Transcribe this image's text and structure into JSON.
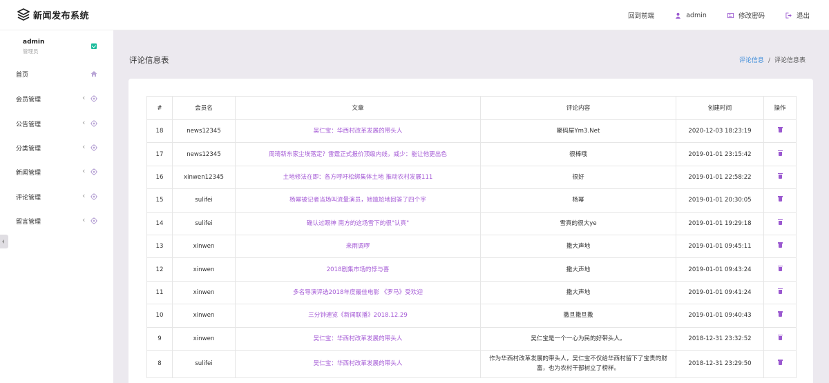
{
  "app": {
    "title": "新闻发布系统"
  },
  "topnav": {
    "home": "回到前端",
    "user": "admin",
    "password": "修改密码",
    "logout": "退出"
  },
  "profile": {
    "name": "admin",
    "role": "管理员"
  },
  "sidebar": {
    "items": [
      {
        "label": "首页",
        "icon": "home-icon"
      },
      {
        "label": "会员管理",
        "icon": "target-icon"
      },
      {
        "label": "公告管理",
        "icon": "target-icon"
      },
      {
        "label": "分类管理",
        "icon": "target-icon"
      },
      {
        "label": "新闻管理",
        "icon": "target-icon"
      },
      {
        "label": "评论管理",
        "icon": "target-icon"
      },
      {
        "label": "留言管理",
        "icon": "target-icon"
      }
    ]
  },
  "page": {
    "title": "评论信息表",
    "breadcrumb": {
      "parent": "评论信息",
      "separator": "/",
      "current": "评论信息表"
    }
  },
  "table": {
    "headers": [
      "#",
      "会员名",
      "文章",
      "评论内容",
      "创建时间",
      "操作"
    ],
    "rows": [
      {
        "id": "18",
        "user": "news12345",
        "article": "吴仁宝：华西村改革发展的带头人",
        "comment": "聚码屋Ym3.Net",
        "time": "2020-12-03 18:23:19"
      },
      {
        "id": "17",
        "user": "news12345",
        "article": "周琦新东家尘埃落定？雷霆正式报价顶级内线，威少：能让他更出色",
        "comment": "很棒哦",
        "time": "2019-01-01 23:15:42"
      },
      {
        "id": "16",
        "user": "xinwen12345",
        "article": "土地修法在即：各方呼吁松绑集体土地 推动农村发展111",
        "comment": "很好",
        "time": "2019-01-01 22:58:22"
      },
      {
        "id": "15",
        "user": "sulifei",
        "article": "杨幂被记者当场叫流量演员，她尴尬地回答了四个字",
        "comment": "杨幂",
        "time": "2019-01-01 20:30:05"
      },
      {
        "id": "14",
        "user": "sulifei",
        "article": "确认过眼神 南方的这场雪下的很\"认真\"",
        "comment": "雪真的很大ye",
        "time": "2019-01-01 19:29:18"
      },
      {
        "id": "13",
        "user": "xinwen",
        "article": "来雨调啰",
        "comment": "撒大声地",
        "time": "2019-01-01 09:45:11"
      },
      {
        "id": "12",
        "user": "xinwen",
        "article": "2018剧集市场的悖与喜",
        "comment": "撒大声地",
        "time": "2019-01-01 09:43:24"
      },
      {
        "id": "11",
        "user": "xinwen",
        "article": "多名导演评选2018年度最佳电影 《罗马》受欢迎",
        "comment": "撒大声地",
        "time": "2019-01-01 09:41:24"
      },
      {
        "id": "10",
        "user": "xinwen",
        "article": "三分钟速览《新闻联播》2018.12.29",
        "comment": "撒旦撒旦撒",
        "time": "2019-01-01 09:40:43"
      },
      {
        "id": "9",
        "user": "xinwen",
        "article": "吴仁宝：华西村改革发展的带头人",
        "comment": "吴仁宝是一个一心为民的好带头人。",
        "time": "2018-12-31 23:32:52"
      },
      {
        "id": "8",
        "user": "sulifei",
        "article": "吴仁宝：华西村改革发展的带头人",
        "comment": "作为华西村改革发展的带头人，吴仁宝不仅给华西村留下了宝贵的财富，也为农村干部树立了榜样。",
        "time": "2018-12-31 23:29:50"
      }
    ]
  },
  "colors": {
    "accent": "#a55bd6",
    "link": "#3b8bda",
    "badge": "#1abc9c"
  }
}
